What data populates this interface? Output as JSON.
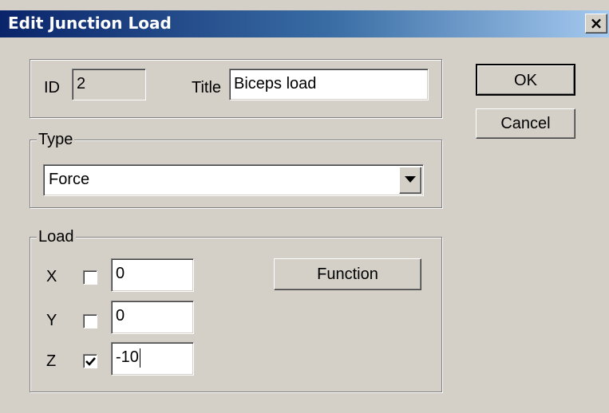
{
  "window": {
    "title": "Edit Junction Load",
    "close_icon": "close-icon"
  },
  "header": {
    "id_label": "ID",
    "id_value": "2",
    "title_label": "Title",
    "title_value": "Biceps load"
  },
  "buttons": {
    "ok": "OK",
    "cancel": "Cancel",
    "function": "Function"
  },
  "type_group": {
    "legend": "Type",
    "selected": "Force",
    "dropdown_icon": "chevron-down-icon"
  },
  "load_group": {
    "legend": "Load",
    "rows": [
      {
        "axis": "X",
        "checked": false,
        "value": "0"
      },
      {
        "axis": "Y",
        "checked": false,
        "value": "0"
      },
      {
        "axis": "Z",
        "checked": true,
        "value": "-10"
      }
    ]
  }
}
